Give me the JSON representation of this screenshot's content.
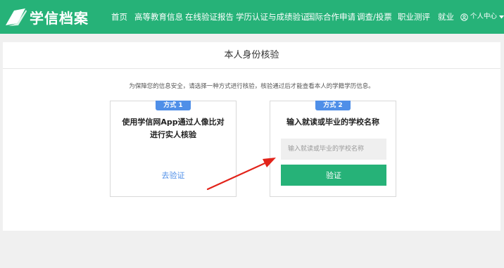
{
  "header": {
    "logo_text": "学信档案",
    "nav": [
      "首页",
      "高等教育信息",
      "在线验证报告",
      "学历认证与成绩验证",
      "国际合作申请",
      "调查/投票",
      "职业测评",
      "就业"
    ],
    "user_menu": "个人中心"
  },
  "page": {
    "title": "本人身份核验",
    "notice": "为保障您的信息安全，请选择一种方式进行核验，核验通过后才能查看本人的学籍学历信息。"
  },
  "method1": {
    "badge": "方式 1",
    "description": "使用学信网App通过人像比对进行实人核验",
    "link_label": "去验证"
  },
  "method2": {
    "badge": "方式 2",
    "description": "输入就读或毕业的学校名称",
    "input_placeholder": "输入就读或毕业的学校名称",
    "input_value": "",
    "button_label": "验证"
  },
  "colors": {
    "brand_green": "#26b278",
    "badge_blue": "#4f8fe8",
    "arrow_red": "#e2231a"
  },
  "icons": {
    "logo": "book-icon",
    "user": "user-circle-icon",
    "dropdown": "caret-down-icon"
  }
}
